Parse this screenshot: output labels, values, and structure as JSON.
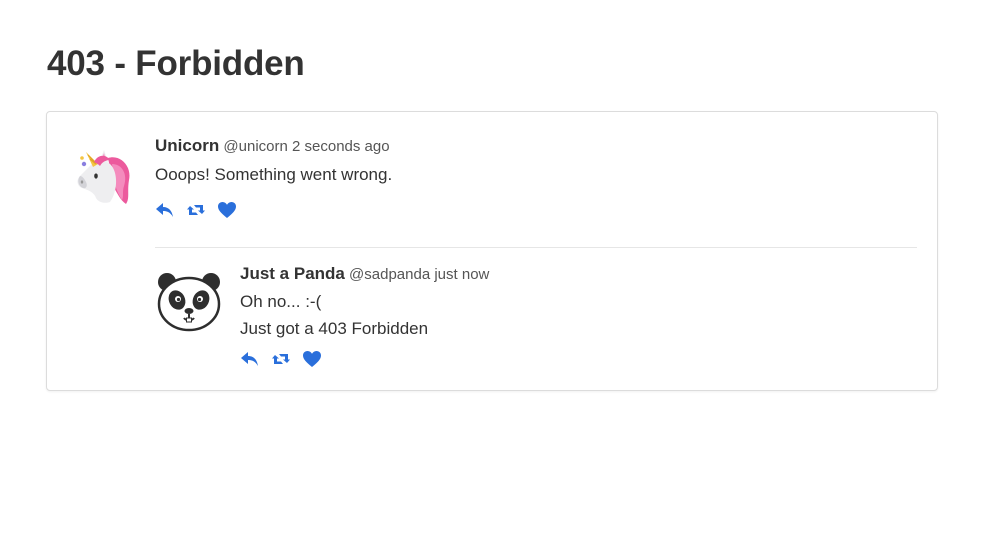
{
  "page": {
    "title": "403 - Forbidden"
  },
  "colors": {
    "accent": "#2a6fdb",
    "text": "#333333",
    "muted": "#555555",
    "border": "#dcdcdc"
  },
  "tweet": {
    "avatar_icon": "unicorn-icon",
    "name": "Unicorn",
    "handle": "@unicorn",
    "time": "2 seconds ago",
    "text": "Ooops! Something went wrong.",
    "actions": [
      "reply-icon",
      "retweet-icon",
      "heart-icon"
    ]
  },
  "reply": {
    "avatar_icon": "panda-icon",
    "name": "Just a Panda",
    "handle": "@sadpanda",
    "time": "just now",
    "text_lines": [
      "Oh no... :-(",
      "Just got a 403 Forbidden"
    ],
    "actions": [
      "reply-icon",
      "retweet-icon",
      "heart-icon"
    ]
  }
}
